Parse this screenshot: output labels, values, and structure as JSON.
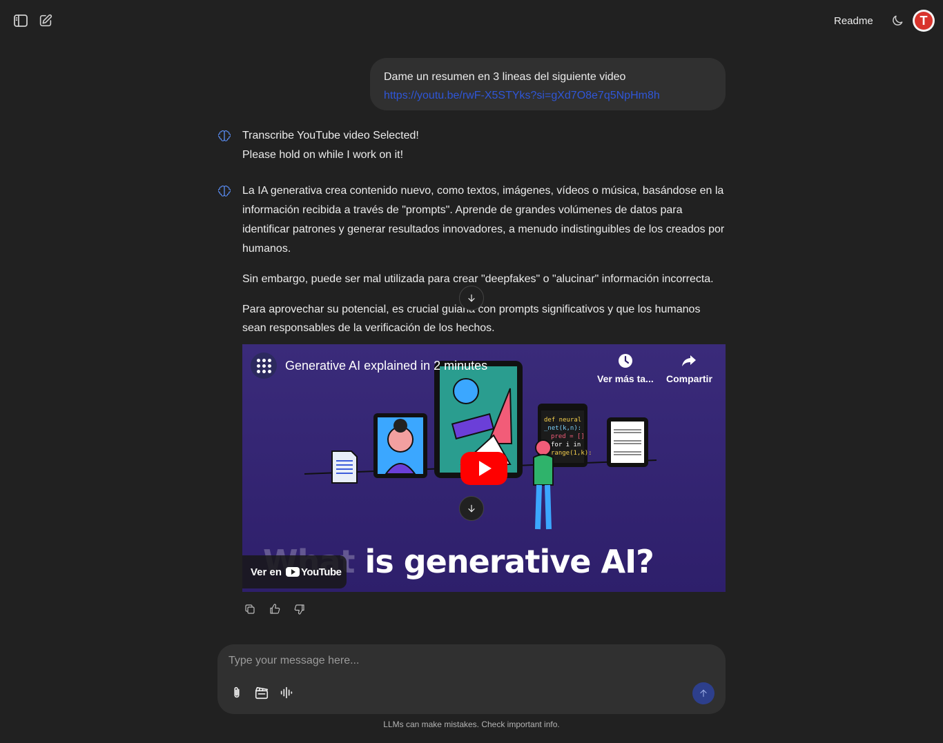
{
  "header": {
    "sidebar_toggle_icon": "sidebar-icon",
    "new_chat_icon": "edit-icon",
    "readme_label": "Readme",
    "theme_icon": "moon-icon",
    "avatar_initial": "T"
  },
  "user_message": {
    "text": "Dame un resumen en 3 lineas del siguiente video",
    "link": "https://youtu.be/rwF-X5STYks?si=gXd7O8e7q5NpHm8h"
  },
  "assistant_status": {
    "line1": "Transcribe YouTube video Selected!",
    "line2": "Please hold on while I work on it!"
  },
  "assistant_reply": {
    "p1": "La IA generativa crea contenido nuevo, como textos, imágenes, vídeos o música, basándose en la información recibida a través de \"prompts\". Aprende de grandes volúmenes de datos para identificar patrones y generar resultados innovadores, a menudo indistinguibles de los creados por humanos.",
    "p2": "Sin embargo, puede ser mal utilizada para crear \"deepfakes\" o \"alucinar\" información incorrecta.",
    "p3": "Para aprovechar su potencial, es crucial guiarla con prompts significativos y que los humanos sean responsables de la verificación de los hechos."
  },
  "video": {
    "title": "Generative AI explained in 2 minutes",
    "watch_later": "Ver más ta...",
    "share": "Compartir",
    "overlay_text_faded": "What",
    "overlay_text": " is generative AI?",
    "watch_on": "Ver en",
    "youtube_brand": "YouTube",
    "accent_color": "#ff0000"
  },
  "composer": {
    "placeholder": "Type your message here...",
    "attach_icon": "paperclip-icon",
    "video_icon": "clapperboard-icon",
    "voice_icon": "audio-waveform-icon",
    "send_icon": "arrow-up-icon"
  },
  "footer": {
    "note": "LLMs can make mistakes. Check important info."
  }
}
